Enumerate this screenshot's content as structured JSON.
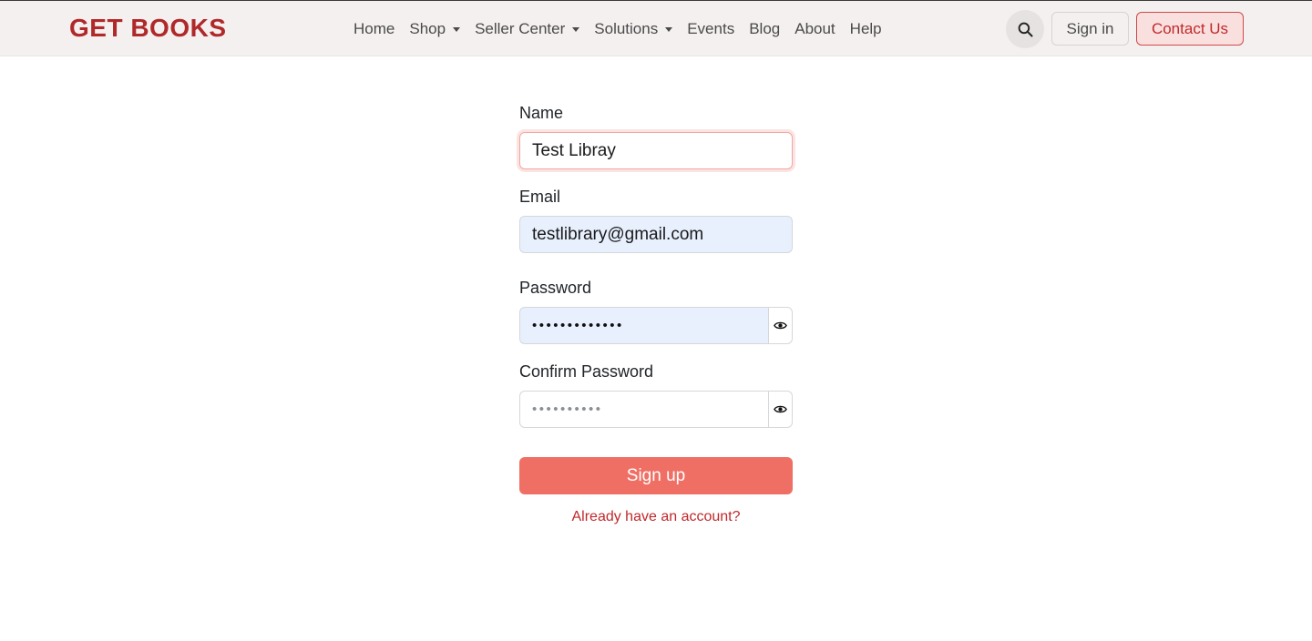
{
  "header": {
    "brand": "GET BOOKS",
    "nav": [
      {
        "label": "Home"
      },
      {
        "label": "Shop"
      },
      {
        "label": "Seller Center"
      },
      {
        "label": "Solutions"
      },
      {
        "label": "Events"
      },
      {
        "label": "Blog"
      },
      {
        "label": "About"
      },
      {
        "label": "Help"
      }
    ],
    "search_icon": "search-icon",
    "signin_label": "Sign in",
    "contact_label": "Contact Us"
  },
  "form": {
    "name": {
      "label": "Name",
      "value": "Test Libray"
    },
    "email": {
      "label": "Email",
      "value": "testlibrary@gmail.com"
    },
    "password": {
      "label": "Password",
      "masked": "•••••••••••••"
    },
    "confirm_password": {
      "label": "Confirm Password",
      "placeholder": "••••••••••"
    },
    "eye_icon": "eye-icon",
    "submit_label": "Sign up",
    "login_link": "Already have an account?"
  },
  "colors": {
    "brand": "#b0292a",
    "primary_button": "#ef6f65",
    "link": "#c0292c",
    "autofill_bg": "#e8f0fe"
  }
}
